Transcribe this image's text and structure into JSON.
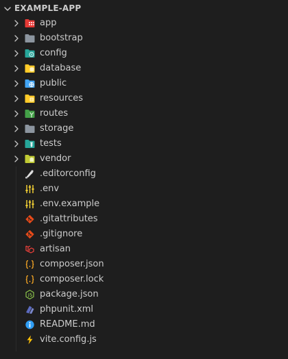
{
  "explorer": {
    "section_title": "EXAMPLE-APP",
    "folders": [
      {
        "label": "app",
        "icon": "app-folder-icon"
      },
      {
        "label": "bootstrap",
        "icon": "folder-icon"
      },
      {
        "label": "config",
        "icon": "config-folder-icon"
      },
      {
        "label": "database",
        "icon": "database-folder-icon"
      },
      {
        "label": "public",
        "icon": "public-folder-icon"
      },
      {
        "label": "resources",
        "icon": "resources-folder-icon"
      },
      {
        "label": "routes",
        "icon": "routes-folder-icon"
      },
      {
        "label": "storage",
        "icon": "folder-icon"
      },
      {
        "label": "tests",
        "icon": "tests-folder-icon"
      },
      {
        "label": "vendor",
        "icon": "vendor-folder-icon"
      }
    ],
    "files": [
      {
        "label": ".editorconfig",
        "icon": "editorconfig-icon"
      },
      {
        "label": ".env",
        "icon": "env-icon"
      },
      {
        "label": ".env.example",
        "icon": "env-icon"
      },
      {
        "label": ".gitattributes",
        "icon": "git-icon"
      },
      {
        "label": ".gitignore",
        "icon": "git-icon"
      },
      {
        "label": "artisan",
        "icon": "laravel-icon"
      },
      {
        "label": "composer.json",
        "icon": "json-braces-icon"
      },
      {
        "label": "composer.lock",
        "icon": "json-braces-icon"
      },
      {
        "label": "package.json",
        "icon": "nodejs-icon"
      },
      {
        "label": "phpunit.xml",
        "icon": "phpunit-icon"
      },
      {
        "label": "README.md",
        "icon": "info-icon"
      },
      {
        "label": "vite.config.js",
        "icon": "vite-icon"
      }
    ]
  },
  "colors": {
    "background": "#1e1e1e",
    "text": "#cccccc",
    "folder_grey": "#8c959f",
    "folder_red": "#e53935",
    "folder_teal": "#26a69a",
    "folder_yellow": "#ffca28",
    "folder_blue": "#42a5f5",
    "folder_green": "#43a047",
    "folder_lime": "#c0ca33",
    "git_orange": "#e64a19",
    "laravel_red": "#f4423c",
    "json_yellow": "#f9a825",
    "node_green": "#8bc34a",
    "phpunit_indigo": "#5c6bc0",
    "info_blue": "#2f9df4",
    "vite_yellow": "#ffc107"
  }
}
